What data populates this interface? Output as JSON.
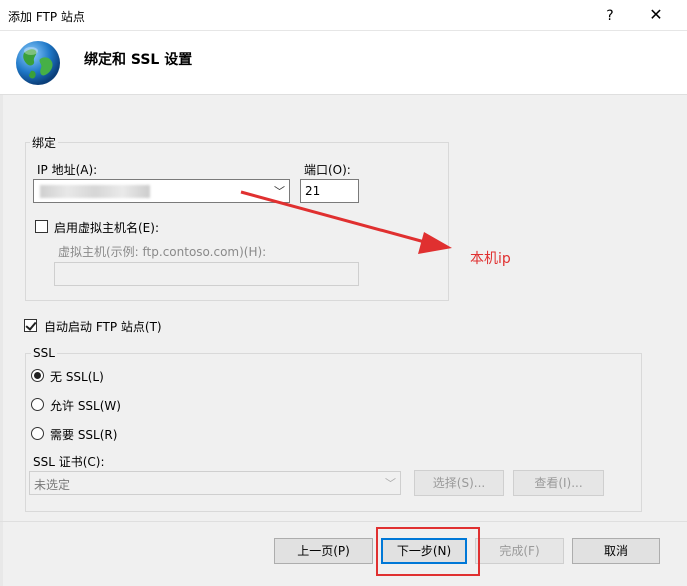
{
  "window": {
    "title": "添加 FTP 站点",
    "help_glyph": "?",
    "close_glyph": "✕"
  },
  "header": {
    "title": "绑定和 SSL 设置",
    "icon": "globe-icon"
  },
  "binding": {
    "group_label": "绑定",
    "ip_label": "IP 地址(A):",
    "ip_value": "",
    "port_label": "端口(O):",
    "port_value": "21",
    "vhost_check_label": "启用虚拟主机名(E):",
    "vhost_checked": false,
    "vhost_label": "虚拟主机(示例: ftp.contoso.com)(H):",
    "vhost_value": ""
  },
  "autostart": {
    "label": "自动启动 FTP 站点(T)",
    "checked": true
  },
  "ssl": {
    "group_label": "SSL",
    "options": [
      {
        "label": "无 SSL(L)",
        "selected": true
      },
      {
        "label": "允许 SSL(W)",
        "selected": false
      },
      {
        "label": "需要 SSL(R)",
        "selected": false
      }
    ],
    "cert_label": "SSL 证书(C):",
    "cert_value": "未选定",
    "select_button": "选择(S)...",
    "view_button": "查看(I)..."
  },
  "footer": {
    "prev_button": "上一页(P)",
    "next_button": "下一步(N)",
    "finish_button": "完成(F)",
    "cancel_button": "取消"
  },
  "annotation": {
    "text": "本机ip",
    "color": "#e03030"
  }
}
